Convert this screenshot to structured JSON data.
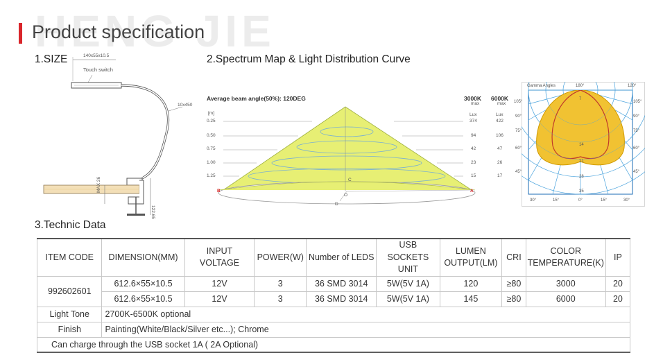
{
  "header": {
    "watermark": "HENG JIE",
    "title": "Product specification"
  },
  "size_section": {
    "title": "1.SIZE",
    "dims_head": "140x55x10.5",
    "touch_switch": "Touch switch",
    "arm": "10x450",
    "max_clamp": "MAX 26",
    "height": "122.65"
  },
  "spectrum_section": {
    "title": "2.Spectrum Map & Light Distribution Curve",
    "beam_angle": "Average beam angle(50%): 120DEG",
    "unit": "[m]",
    "col_3000": "3000K",
    "col_6000": "6000K",
    "max_label": "max",
    "lux_label": "Lux",
    "rows": [
      {
        "d": "0.25",
        "a": "374",
        "b": "422"
      },
      {
        "d": "0.50",
        "a": "94",
        "b": "106"
      },
      {
        "d": "0.75",
        "a": "42",
        "b": "47"
      },
      {
        "d": "1.00",
        "a": "23",
        "b": "26"
      },
      {
        "d": "1.25",
        "a": "15",
        "b": "17"
      }
    ],
    "pt_b": "B",
    "pt_a": "A",
    "pt_c": "C",
    "pt_o": "O",
    "pt_d": "D"
  },
  "polar": {
    "gamma": "Gamma Angles",
    "top_180": "180°",
    "top_120": "120°",
    "left_angles": [
      "105°",
      "90°",
      "75°",
      "60°",
      "45°"
    ],
    "right_angles": [
      "105°",
      "90°",
      "75°",
      "60°",
      "45°"
    ],
    "bottom_angles": [
      "30°",
      "15°",
      "0°",
      "15°",
      "30°"
    ],
    "radial": [
      "7",
      "14",
      "21",
      "28",
      "35"
    ]
  },
  "technic": {
    "title": "3.Technic Data",
    "headers": {
      "item": "ITEM CODE",
      "dim": "DIMENSION(MM)",
      "volt": "INPUT VOLTAGE",
      "power": "POWER(W)",
      "leds": "Number of LEDS",
      "usb1": "USB SOCKETS",
      "usb2": "UNIT",
      "lum1": "LUMEN",
      "lum2": "OUTPUT(LM)",
      "cri": "CRI",
      "color1": "COLOR",
      "color2": "TEMPERATURE(K)",
      "ip": "IP"
    },
    "item_code": "992602601",
    "rows": [
      {
        "dim": "612.6×55×10.5",
        "volt": "12V",
        "power": "3",
        "leds": "36 SMD 3014",
        "usb": "5W(5V 1A)",
        "lumen": "120",
        "cri": "≥80",
        "cct": "3000",
        "ip": "20"
      },
      {
        "dim": "612.6×55×10.5",
        "volt": "12V",
        "power": "3",
        "leds": "36 SMD 3014",
        "usb": "5W(5V 1A)",
        "lumen": "145",
        "cri": "≥80",
        "cct": "6000",
        "ip": "20"
      }
    ],
    "light_tone_label": "Light Tone",
    "light_tone_value": "2700K-6500K optional",
    "finish_label": "Finish",
    "finish_value": "Painting(White/Black/Silver etc...); Chrome",
    "note": "Can charge through the USB socket 1A ( 2A Optional)"
  }
}
